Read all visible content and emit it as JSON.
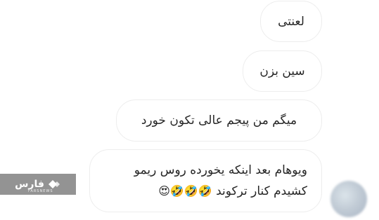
{
  "messages": [
    {
      "text": "لعنتی"
    },
    {
      "text": "سین بزن"
    },
    {
      "text": "میگم من پیجم عالی تکون خورد"
    },
    {
      "text_line1": "ویوهام بعد اینکه یخورده روس ریمو",
      "text_line2": "کشیدم کنار ترکوند",
      "emojis": "🤣🤣🤣😍"
    }
  ],
  "watermark": {
    "text": "فارس",
    "subtext": "FARSNEWS"
  },
  "colors": {
    "bubble_border": "#ededed",
    "text": "#262626",
    "watermark_bg": "#8a8a8a"
  }
}
